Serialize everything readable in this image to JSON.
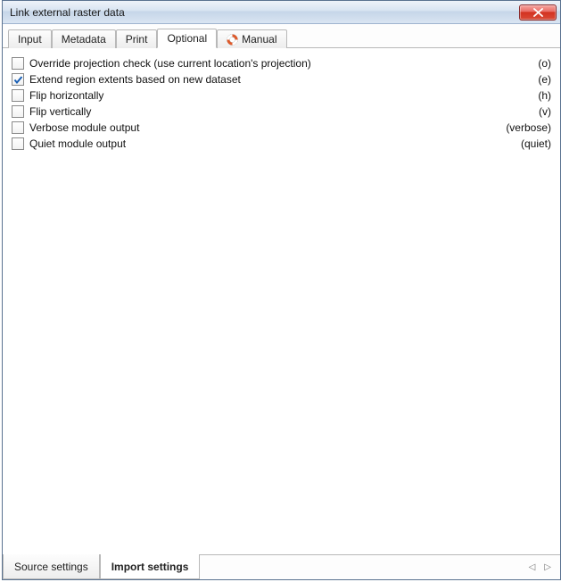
{
  "window": {
    "title": "Link external raster data"
  },
  "tabs_top": [
    {
      "label": "Input",
      "active": false,
      "icon": null
    },
    {
      "label": "Metadata",
      "active": false,
      "icon": null
    },
    {
      "label": "Print",
      "active": false,
      "icon": null
    },
    {
      "label": "Optional",
      "active": true,
      "icon": null
    },
    {
      "label": "Manual",
      "active": false,
      "icon": "manual"
    }
  ],
  "options": [
    {
      "label": "Override projection check (use current location's projection)",
      "flag": "(o)",
      "checked": false
    },
    {
      "label": "Extend region extents based on new dataset",
      "flag": "(e)",
      "checked": true
    },
    {
      "label": "Flip horizontally",
      "flag": "(h)",
      "checked": false
    },
    {
      "label": "Flip vertically",
      "flag": "(v)",
      "checked": false
    },
    {
      "label": "Verbose module output",
      "flag": "(verbose)",
      "checked": false
    },
    {
      "label": "Quiet module output",
      "flag": "(quiet)",
      "checked": false
    }
  ],
  "tabs_bottom": [
    {
      "label": "Source settings",
      "active": false
    },
    {
      "label": "Import settings",
      "active": true
    }
  ],
  "arrows": {
    "prev": "◁",
    "next": "▷"
  }
}
